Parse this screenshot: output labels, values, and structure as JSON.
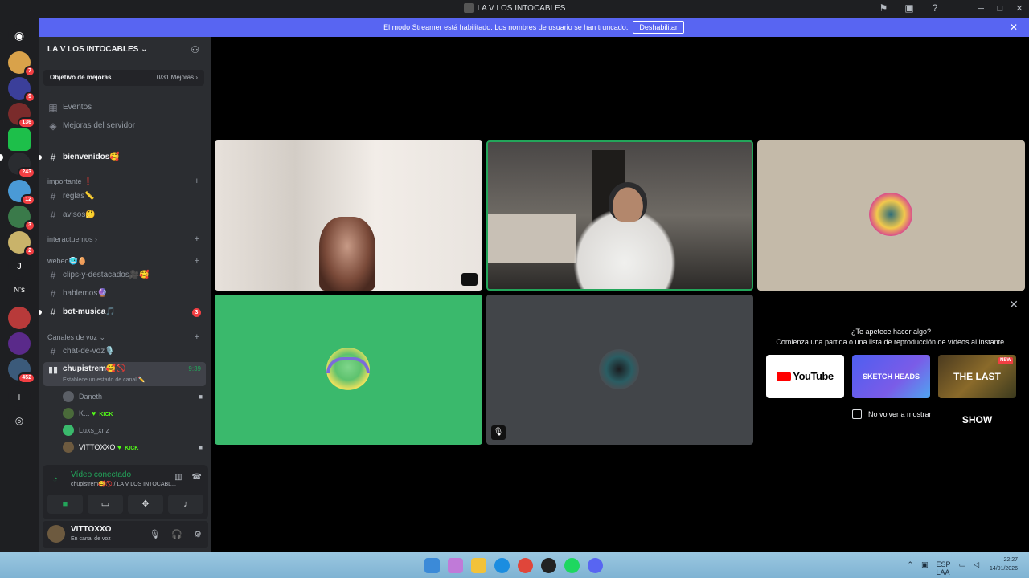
{
  "window": {
    "title": "LA V LOS INTOCABLES"
  },
  "banner": {
    "text": "El modo Streamer está habilitado. Los nombres de usuario se han truncado.",
    "button": "Deshabilitar",
    "close": "✕"
  },
  "rail": {
    "badges": [
      "7",
      "9",
      "136",
      "243",
      "12",
      "3",
      "2",
      "452"
    ],
    "letters": [
      "J",
      "N's"
    ]
  },
  "server": {
    "name": "LA V LOS INTOCABLES",
    "boost_goal": "Objetivo de mejoras",
    "boost_count": "0/31 Mejoras",
    "events": "Eventos",
    "boosts": "Mejoras del servidor"
  },
  "channels": {
    "bienvenidos": "bienvenidos🥰",
    "cat_importante": "importante ❗",
    "reglas": "reglas📏",
    "avisos": "avisos🤔",
    "cat_interactuemos": "interactuemos",
    "cat_webeo": "webeo🥶🥚",
    "clips": "clips-y-destacados🎥🥰",
    "hablemos": "hablemos🔮",
    "bot_musica": "bot-musica🎵",
    "bot_musica_mentions": "3",
    "cat_voz": "Canales de voz",
    "chat_voz": "chat-de-voz🎙️"
  },
  "voice_channel": {
    "name": "chupistrem🥰🚫",
    "status": "Establece un estado de canal ✏️",
    "time": "9:39",
    "members": [
      {
        "name": "Daneth",
        "kick": ""
      },
      {
        "name": "K...",
        "kick": "KICK"
      },
      {
        "name": "Luxs_xnz",
        "kick": ""
      },
      {
        "name": "VITTOXXO",
        "kick": "KICK"
      }
    ]
  },
  "voice_panel": {
    "status": "Vídeo conectado",
    "channel": "chupistrem🥰🚫 / LA V LOS INTOCABL..."
  },
  "user": {
    "name": "VITTOXXO",
    "status": "En canal de voz"
  },
  "activity": {
    "question": "¿Te apetece hacer algo?",
    "subtitle": "Comienza una partida o una lista de reproducción de vídeos al instante.",
    "cards": [
      "YouTube",
      "SKETCH HEADS",
      "THE LAST SHOW"
    ],
    "new_badge": "NEW",
    "dont_show": "No volver a mostrar"
  },
  "tile_more": "···",
  "taskbar": {
    "lang": "ESP",
    "lang2": "LAA",
    "time": "22:27",
    "date": "14/01/2026"
  },
  "colors": {
    "accent": "#5865f2",
    "online": "#23a55a",
    "danger": "#f23f43",
    "kick": "#53fc18"
  }
}
